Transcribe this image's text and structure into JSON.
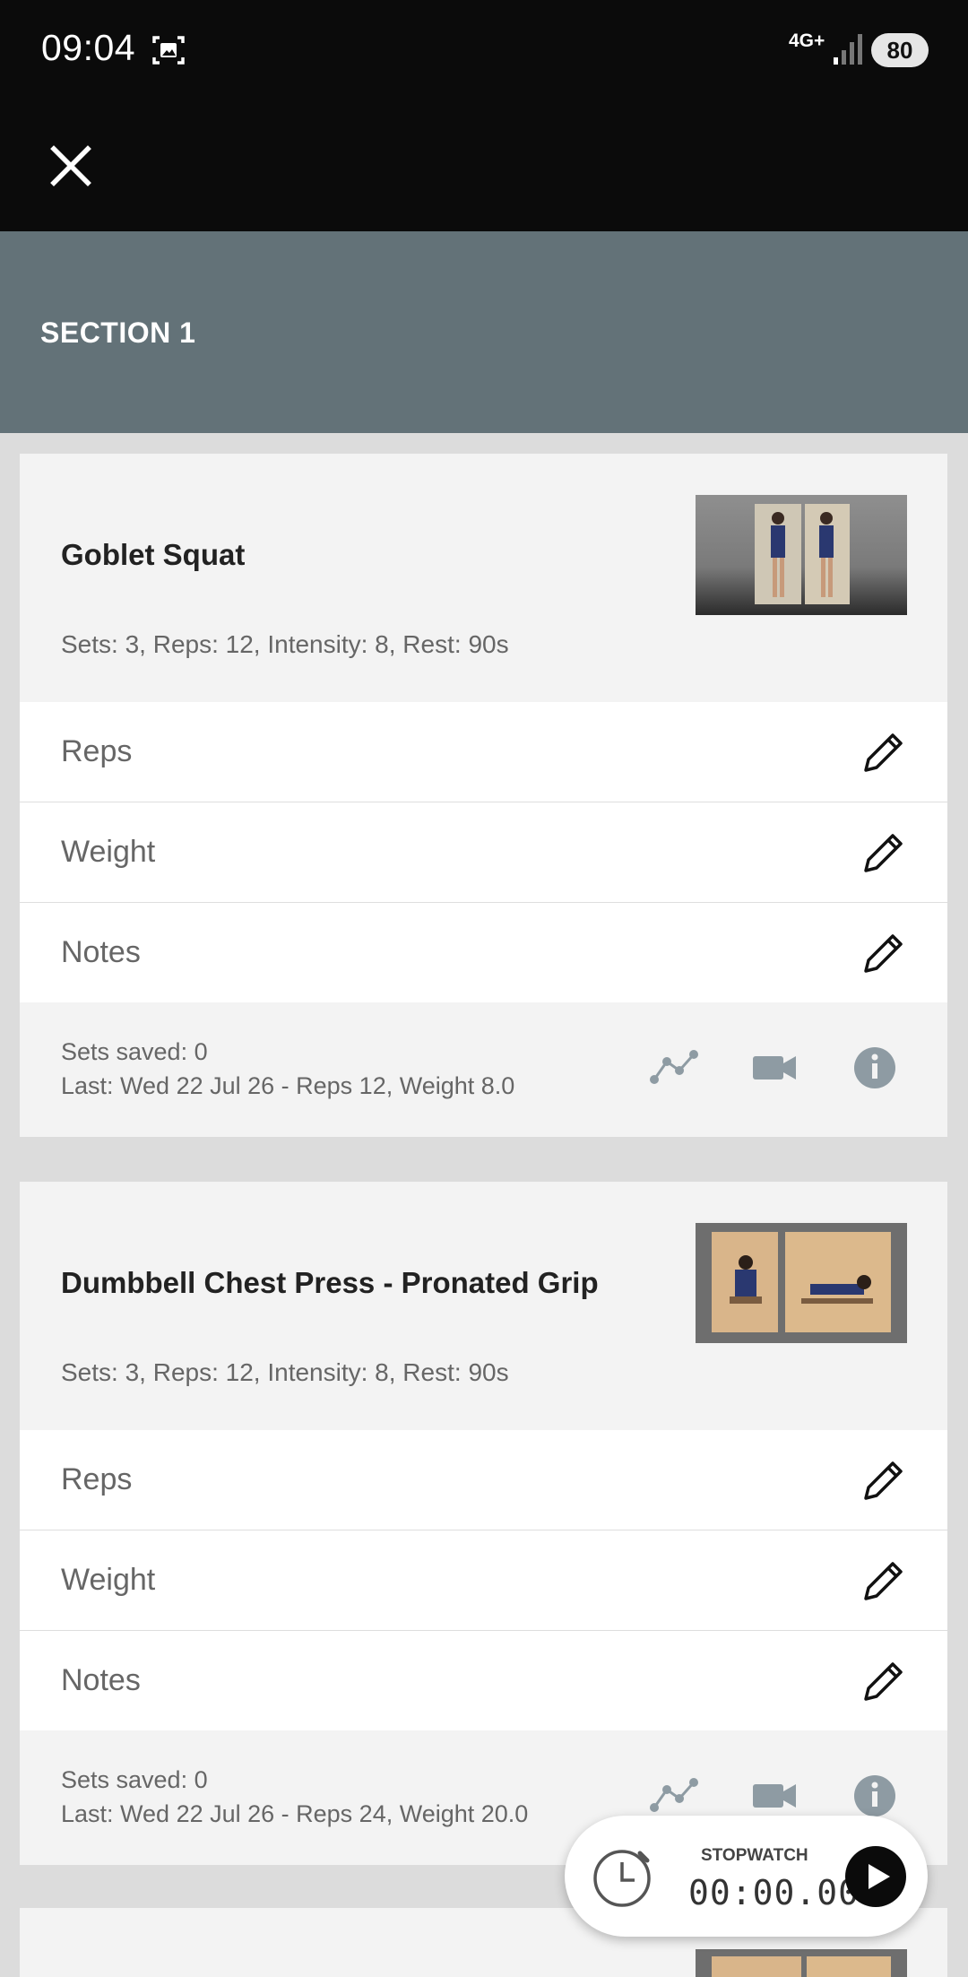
{
  "status_bar": {
    "time": "09:04",
    "network": "4G+",
    "battery": "80"
  },
  "section": {
    "title": "SECTION 1"
  },
  "exercises": [
    {
      "title": "Goblet Squat",
      "summary": "Sets: 3, Reps: 12, Intensity: 8, Rest: 90s",
      "rows": [
        "Reps",
        "Weight",
        "Notes"
      ],
      "sets_saved": "Sets saved: 0",
      "last": "Last: Wed 22 Jul 26 - Reps 12, Weight 8.0"
    },
    {
      "title": "Dumbbell Chest Press - Pronated Grip",
      "summary": "Sets: 3, Reps: 12, Intensity: 8, Rest: 90s",
      "rows": [
        "Reps",
        "Weight",
        "Notes"
      ],
      "sets_saved": "Sets saved: 0",
      "last": "Last: Wed 22 Jul 26 - Reps 24, Weight 20.0"
    }
  ],
  "stopwatch": {
    "label": "STOPWATCH",
    "time": "00:00.00"
  },
  "icons": {
    "close": "close-icon",
    "edit": "pencil-icon",
    "progress": "chart-line-icon",
    "video": "video-camera-icon",
    "info": "info-icon",
    "play": "play-icon",
    "timer": "stopwatch-icon"
  },
  "colors": {
    "section_header": "#637278",
    "top_bar": "#0b0b0b",
    "icon_gray": "#8e9ba3"
  }
}
